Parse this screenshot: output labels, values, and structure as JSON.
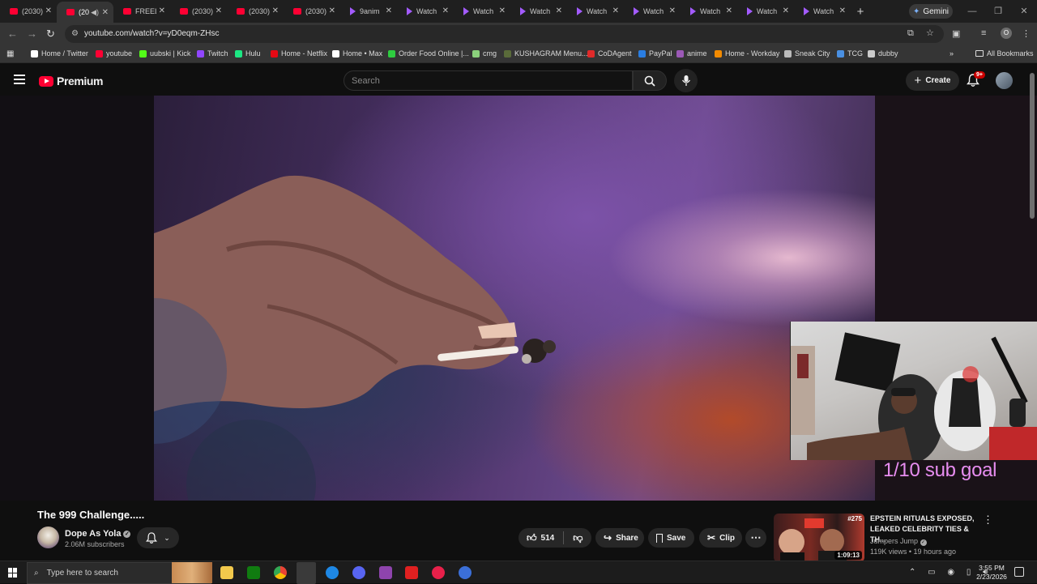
{
  "browser": {
    "tabs": [
      {
        "title": "(2030)",
        "icon": "youtube-icon",
        "active": false
      },
      {
        "title": "(20",
        "icon": "youtube-icon",
        "active": true,
        "audio": true
      },
      {
        "title": "FREEL",
        "icon": "youtube-icon",
        "active": false
      },
      {
        "title": "(2030)",
        "icon": "youtube-icon",
        "active": false
      },
      {
        "title": "(2030)",
        "icon": "youtube-icon",
        "active": false
      },
      {
        "title": "(2030)",
        "icon": "youtube-icon",
        "active": false
      },
      {
        "title": "9anim",
        "icon": "play-triangle-icon",
        "active": false
      },
      {
        "title": "Watch",
        "icon": "play-triangle-icon",
        "active": false
      },
      {
        "title": "Watch",
        "icon": "play-triangle-icon",
        "active": false
      },
      {
        "title": "Watch",
        "icon": "play-triangle-icon",
        "active": false
      },
      {
        "title": "Watch",
        "icon": "play-triangle-icon",
        "active": false
      },
      {
        "title": "Watch",
        "icon": "play-triangle-icon",
        "active": false
      },
      {
        "title": "Watch",
        "icon": "play-triangle-icon",
        "active": false
      },
      {
        "title": "Watch",
        "icon": "play-triangle-icon",
        "active": false
      },
      {
        "title": "Watch",
        "icon": "play-triangle-icon",
        "active": false
      }
    ],
    "gemini_label": "Gemini",
    "url": "youtube.com/watch?v=yD0eqm-ZHsc",
    "profile_initial": "O",
    "bookmarks": [
      {
        "label": "Home / Twitter",
        "color": "#ffffff"
      },
      {
        "label": "youtube",
        "color": "#ff0033"
      },
      {
        "label": "uubski | Kick",
        "color": "#53fc18"
      },
      {
        "label": "Twitch",
        "color": "#9146ff"
      },
      {
        "label": "Hulu",
        "color": "#1ce783"
      },
      {
        "label": "Home - Netflix",
        "color": "#e50914"
      },
      {
        "label": "Home • Max",
        "color": "#ffffff"
      },
      {
        "label": "Order Food Online |...",
        "color": "#2ecc40"
      },
      {
        "label": "cmg",
        "color": "#8bd17c"
      },
      {
        "label": "KUSHAGRAM Menu...",
        "color": "#5a6b3a"
      },
      {
        "label": "CoDAgent",
        "color": "#e02a2a"
      },
      {
        "label": "PayPal",
        "color": "#2a7de1"
      },
      {
        "label": "anime",
        "color": "#9b59b6"
      },
      {
        "label": "Home - Workday",
        "color": "#f38b00"
      },
      {
        "label": "Sneak City",
        "color": "#bbbbbb"
      },
      {
        "label": "TCG",
        "color": "#4a90e2"
      },
      {
        "label": "dubby",
        "color": "#cccccc"
      }
    ],
    "all_bookmarks": "All Bookmarks"
  },
  "youtube": {
    "logo_text": "Premium",
    "search_placeholder": "Search",
    "create_label": "Create",
    "notif_count": "9+",
    "video": {
      "title": "The 999 Challenge.....",
      "channel": "Dope As Yola",
      "subscribers": "2.06M subscribers",
      "likes": "514",
      "share_label": "Share",
      "save_label": "Save",
      "clip_label": "Clip",
      "overlay_text": "1/10 sub goal"
    },
    "recommendation": {
      "title": "EPSTEIN RITUALS EXPOSED, LEAKED CELEBRITY TIES & TH...",
      "channel": "Jumpers Jump",
      "meta": "119K views • 19 hours ago",
      "duration": "1:09:13",
      "episode": "#275"
    }
  },
  "taskbar": {
    "search_placeholder": "Type here to search",
    "time": "3:55 PM",
    "date": "2/23/2026"
  },
  "colors": {
    "brand": "#ff0033",
    "overlay": "#e78df0"
  }
}
